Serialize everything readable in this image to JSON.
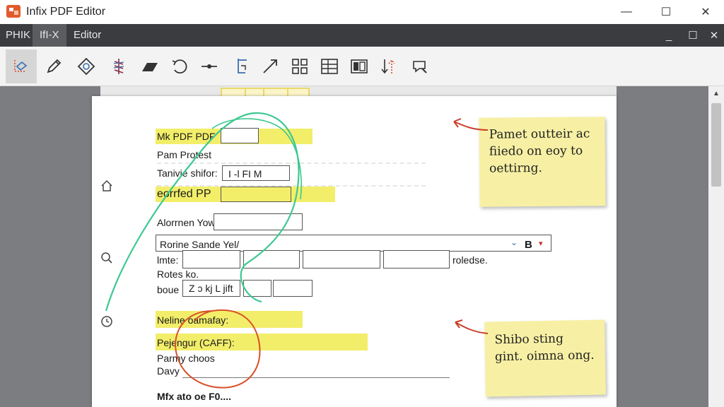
{
  "app": {
    "title": "Infix PDF Editor"
  },
  "window_controls": {
    "minimize": "—",
    "maximize": "☐",
    "close": "✕"
  },
  "menu": {
    "items": [
      "PHIK",
      "IfI-X",
      "Editor"
    ],
    "active_index": 1,
    "controls": {
      "minimize": "_",
      "restore": "☐",
      "close": "✕"
    }
  },
  "toolbar": {
    "tools": [
      "select-tool",
      "pencil-tool",
      "stamp-tool",
      "highlight-tool",
      "eraser-tool",
      "undo-tool",
      "line-tool",
      "text-tool",
      "arrow-tool",
      "grid-tool",
      "table-tool",
      "page-tool",
      "split-tool",
      "find-tool"
    ],
    "selected_index": 0
  },
  "page": {
    "form": {
      "title": "Mk PDF PDF",
      "subtitle": "Pam Protest",
      "row1_label": "Tanivie shifor:",
      "row1_value": "I -l FI M",
      "section1": "eorrfed PP",
      "row2_label": "Alorrnen Yow",
      "row3_label": "Rorine Sande Yel/",
      "row3_dropdown_value": "B",
      "row4_label": "lmte:",
      "row4_suffix": "roledse.",
      "row5_label": "Rotes ko.",
      "row6_label": "boue",
      "row6_value": "Z ɔ kj L jift",
      "section2": "Neline oamafay:",
      "section3": "Pejengur (CAFF):",
      "row7_label": "Parmy choos",
      "row8_label": "Davy",
      "footer": "Mfx ato oe F0...."
    },
    "notes": [
      {
        "text": "Pamet outteir ac fiiedo on eoy to oettirng."
      },
      {
        "text": "Shibo sting gint. oimna ong."
      }
    ]
  },
  "colors": {
    "highlight": "#f2ee6a",
    "sticky_note": "#f7f0a4",
    "pen_green": "#3cc890",
    "pen_red": "#d9502a",
    "menubar": "#3a3c40"
  }
}
